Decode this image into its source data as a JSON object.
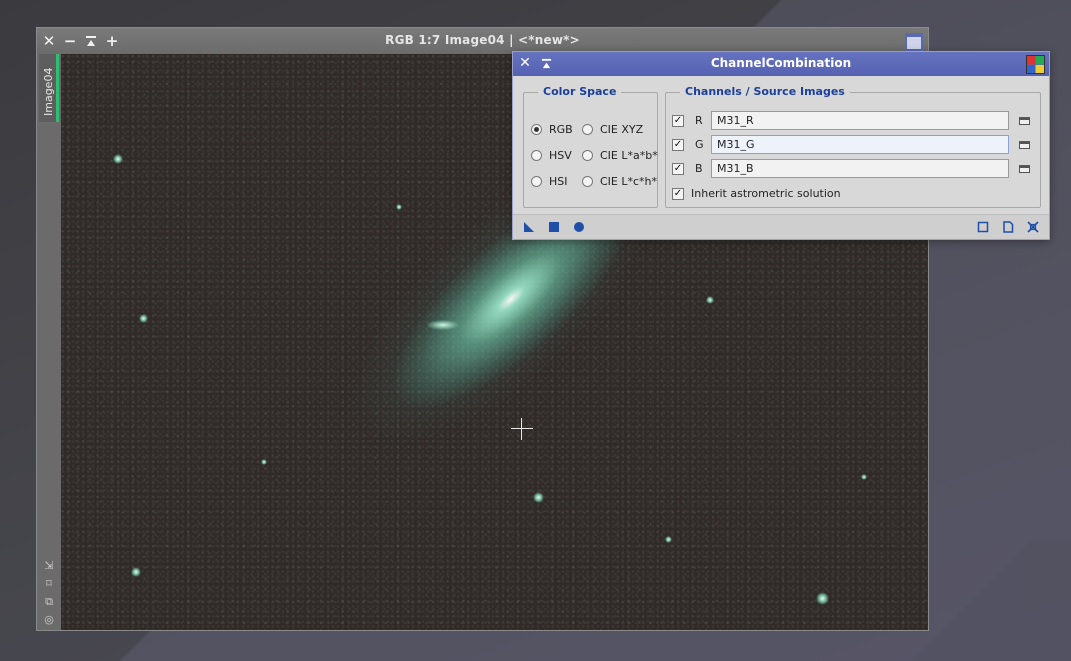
{
  "image_window": {
    "title": "RGB 1:7 Image04 | <*new*>",
    "tab_label": "Image04",
    "controls": [
      "close",
      "minimize",
      "shade",
      "maximize"
    ]
  },
  "dialog": {
    "title": "ChannelCombination",
    "color_space": {
      "title": "Color Space",
      "options": [
        {
          "label": "RGB",
          "checked": true
        },
        {
          "label": "CIE XYZ",
          "checked": false
        },
        {
          "label": "HSV",
          "checked": false
        },
        {
          "label": "CIE L*a*b*",
          "checked": false
        },
        {
          "label": "HSI",
          "checked": false
        },
        {
          "label": "CIE L*c*h*",
          "checked": false
        }
      ]
    },
    "channels": {
      "title": "Channels / Source Images",
      "rows": [
        {
          "letter": "R",
          "checked": true,
          "value": "M31_R"
        },
        {
          "letter": "G",
          "checked": true,
          "value": "M31_G"
        },
        {
          "letter": "B",
          "checked": true,
          "value": "M31_B"
        }
      ],
      "inherit_label": "Inherit astrometric solution",
      "inherit_checked": true
    },
    "colors": {
      "titlebar": "#5a67b8",
      "group_title": "#1b3f9c",
      "tool_blue": "#1f4fa8"
    }
  }
}
